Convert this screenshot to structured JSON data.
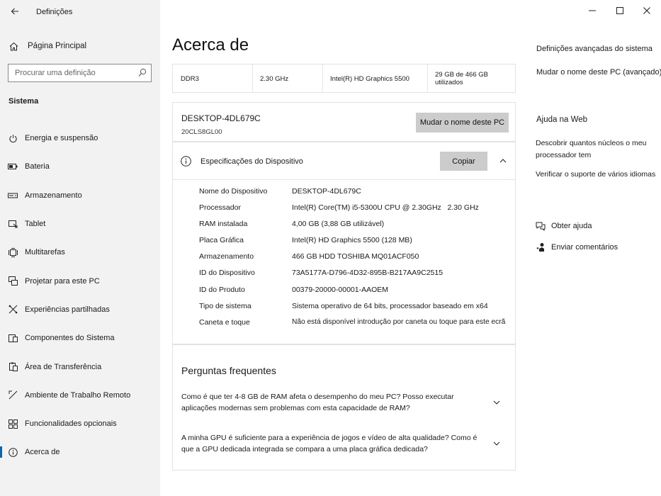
{
  "window": {
    "app_title": "Definições",
    "controls": {
      "minimize": "minimize-icon",
      "maximize": "maximize-icon",
      "close": "close-icon"
    }
  },
  "sidebar": {
    "home_label": "Página Principal",
    "search_placeholder": "Procurar uma definição",
    "section_label": "Sistema",
    "items": [
      {
        "label": "Energia e suspensão",
        "icon": "power-icon"
      },
      {
        "label": "Bateria",
        "icon": "battery-icon"
      },
      {
        "label": "Armazenamento",
        "icon": "storage-icon"
      },
      {
        "label": "Tablet",
        "icon": "tablet-icon"
      },
      {
        "label": "Multitarefas",
        "icon": "multitasking-icon"
      },
      {
        "label": "Projetar para este PC",
        "icon": "project-icon"
      },
      {
        "label": "Experiências partilhadas",
        "icon": "shared-experiences-icon"
      },
      {
        "label": "Componentes do Sistema",
        "icon": "components-icon"
      },
      {
        "label": "Área de Transferência",
        "icon": "clipboard-icon"
      },
      {
        "label": "Ambiente de Trabalho Remoto",
        "icon": "remote-desktop-icon"
      },
      {
        "label": "Funcionalidades opcionais",
        "icon": "optional-features-icon"
      },
      {
        "label": "Acerca de",
        "icon": "info-icon",
        "active": true
      }
    ]
  },
  "main": {
    "title": "Acerca de",
    "spec_strip": [
      "DDR3",
      "2.30 GHz",
      "Intel(R) HD Graphics 5500",
      "29 GB de 466 GB utilizados"
    ],
    "device": {
      "name": "DESKTOP-4DL679C",
      "model": "20CLS8GL00",
      "rename_button": "Mudar o nome deste PC"
    },
    "specs": {
      "title": "Especificações do Dispositivo",
      "copy_button": "Copiar",
      "rows": [
        {
          "key": "Nome do Dispositivo",
          "value": "DESKTOP-4DL679C"
        },
        {
          "key": "Processador",
          "value": "Intel(R) Core(TM) i5-5300U CPU @ 2.30GHz   2.30 GHz"
        },
        {
          "key": "RAM instalada",
          "value": "4,00 GB (3,88 GB utilizável)"
        },
        {
          "key": "Placa Gráfica",
          "value": "Intel(R) HD Graphics 5500 (128 MB)"
        },
        {
          "key": "Armazenamento",
          "value": "466 GB HDD TOSHIBA MQ01ACF050"
        },
        {
          "key": "ID do Dispositivo",
          "value": "73A5177A-D796-4D32-895B-B217AA9C2515"
        },
        {
          "key": "ID do Produto",
          "value": "00379-20000-00001-AAOEM"
        },
        {
          "key": "Tipo de sistema",
          "value": "Sistema operativo de 64 bits, processador baseado em x64"
        },
        {
          "key": "Caneta e toque",
          "value": "Não está disponível introdução por caneta ou toque para este ecrã"
        }
      ]
    },
    "faq": {
      "title": "Perguntas frequentes",
      "items": [
        {
          "q": "Como é que ter 4-8 GB de RAM afeta o desempenho do meu PC? Posso executar aplicações modernas sem problemas com esta capacidade de RAM?"
        },
        {
          "q": "A minha GPU é suficiente para a experiência de jogos e vídeo de alta qualidade? Como é que a GPU dedicada integrada se compara a uma placa gráfica dedicada?"
        }
      ]
    }
  },
  "right": {
    "links": [
      "Definições avançadas do sistema",
      "Mudar o nome deste PC (avançado)"
    ],
    "web_help_title": "Ajuda na Web",
    "web_links": [
      "Descobrir quantos núcleos o meu processador tem",
      "Verificar o suporte de vários idiomas"
    ],
    "get_help": "Obter ajuda",
    "feedback": "Enviar comentários"
  }
}
